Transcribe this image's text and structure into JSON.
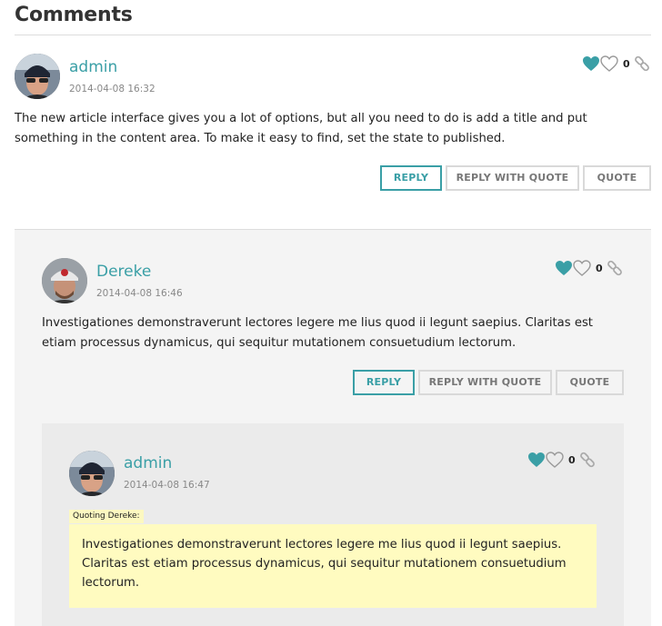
{
  "heading": "Comments",
  "colors": {
    "accent": "#3a9fa6",
    "quote_bg": "#fffbc0",
    "nested_bg": "#f4f4f4"
  },
  "comments": [
    {
      "author": "admin",
      "date": "2014-04-08 16:32",
      "text": "The new article interface gives you a lot of options, but all you need to do is add a title and put something in the content area. To make it easy to find, set the state to published.",
      "likes": "0",
      "actions": {
        "reply": "REPLY",
        "reply_quote": "REPLY WITH QUOTE",
        "quote": "QUOTE"
      }
    },
    {
      "author": "Dereke",
      "date": "2014-04-08 16:46",
      "text": "Investigationes demonstraverunt lectores legere me lius quod ii legunt saepius. Claritas est etiam processus dynamicus, qui sequitur mutationem consuetudium lectorum.",
      "likes": "0",
      "actions": {
        "reply": "REPLY",
        "reply_quote": "REPLY WITH QUOTE",
        "quote": "QUOTE"
      }
    },
    {
      "author": "admin",
      "date": "2014-04-08 16:47",
      "likes": "0",
      "quote_label": "Quoting Dereke:",
      "quote_text": "Investigationes demonstraverunt lectores legere me lius quod ii legunt saepius. Claritas est etiam processus dynamicus, qui sequitur mutationem consuetudium lectorum."
    }
  ],
  "icons": {
    "like": "heart-filled-icon",
    "dislike": "heart-outline-icon",
    "permalink": "link-icon"
  }
}
